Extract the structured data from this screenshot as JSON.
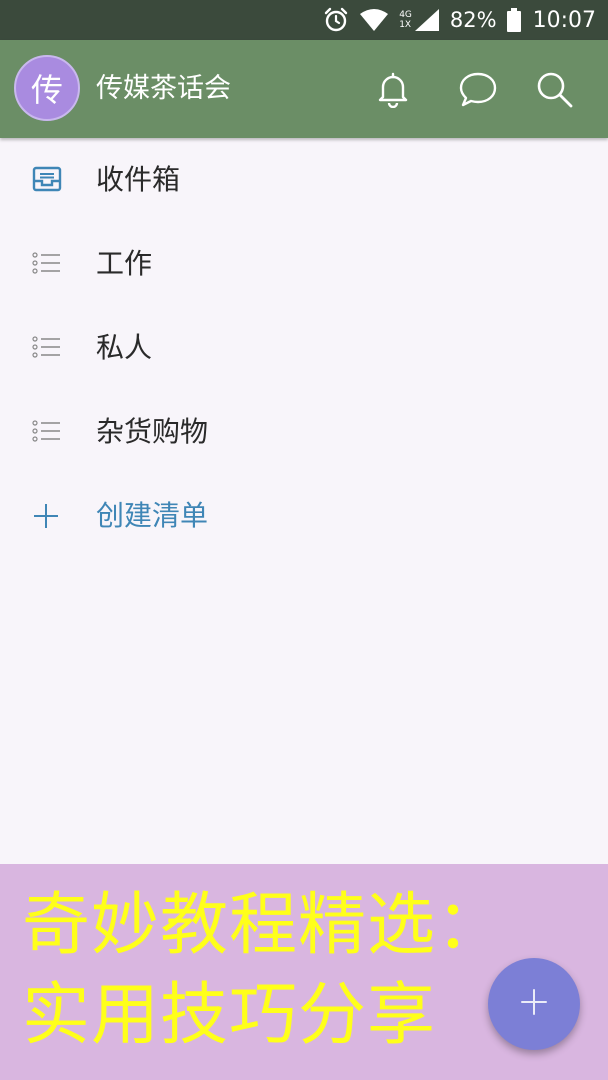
{
  "status_bar": {
    "network": "4G",
    "network_sub": "1X",
    "battery_percent": "82%",
    "time": "10:07",
    "icons": [
      "alarm-icon",
      "wifi-icon",
      "cellular-signal-icon",
      "battery-icon"
    ]
  },
  "app_bar": {
    "avatar_letter": "传",
    "account_name": "传媒茶话会",
    "icons": [
      "bell-icon",
      "chat-bubble-icon",
      "search-icon"
    ]
  },
  "lists": [
    {
      "label": "收件箱",
      "icon": "inbox-icon"
    },
    {
      "label": "工作",
      "icon": "list-icon"
    },
    {
      "label": "私人",
      "icon": "list-icon"
    },
    {
      "label": "杂货购物",
      "icon": "list-icon"
    }
  ],
  "create_list": {
    "label": "创建清单",
    "icon": "plus-icon"
  },
  "banner": {
    "line1": "奇妙教程精选：",
    "line2": "实用技巧分享"
  },
  "fab": {
    "icon": "plus-icon"
  },
  "colors": {
    "status_bar": "#3b4a3c",
    "app_bar": "#6b8e66",
    "avatar": "#a98be0",
    "accent": "#3f86b6",
    "banner_bg": "#d9b6e0",
    "banner_text": "#ffff1a",
    "fab": "#7c7fd6"
  }
}
